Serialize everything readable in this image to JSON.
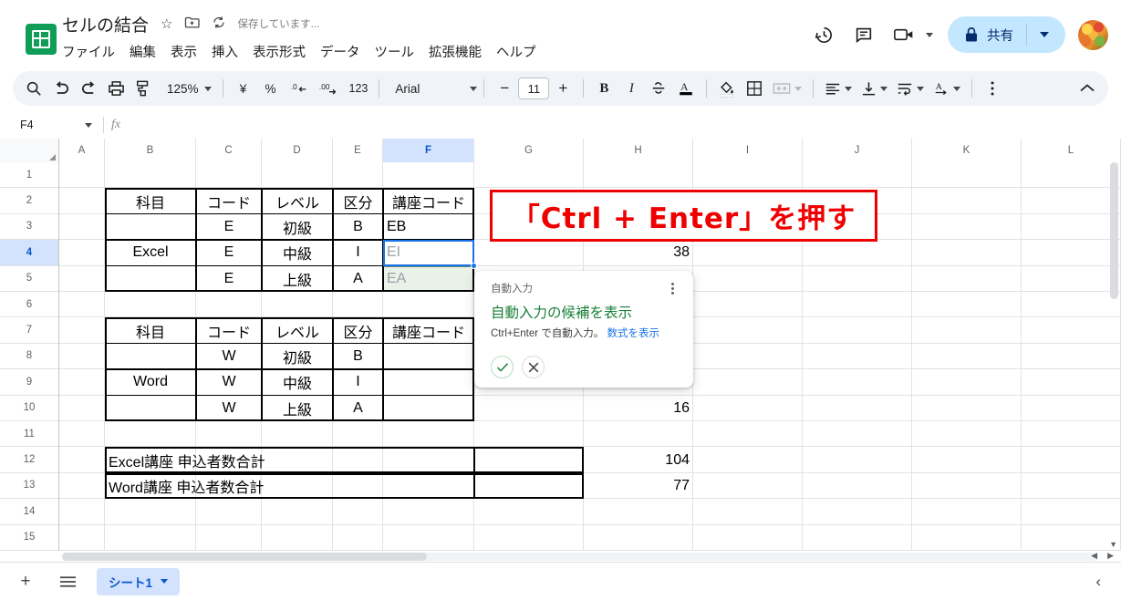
{
  "app": {
    "doc_title": "セルの結合",
    "saving_status": "保存しています...",
    "star_icon": "star-icon",
    "move_icon": "move-to-folder-icon",
    "cloud_icon": "drive-status-icon"
  },
  "menu": {
    "items": [
      {
        "label": "ファイル"
      },
      {
        "label": "編集"
      },
      {
        "label": "表示"
      },
      {
        "label": "挿入"
      },
      {
        "label": "表示形式"
      },
      {
        "label": "データ"
      },
      {
        "label": "ツール"
      },
      {
        "label": "拡張機能"
      },
      {
        "label": "ヘルプ"
      }
    ]
  },
  "top_right": {
    "history_icon": "version-history-icon",
    "comment_icon": "comment-icon",
    "meet_icon": "meet-camera-icon",
    "share_label": "共有",
    "share_bg": "#c2e7ff",
    "share_fg": "#062e6f"
  },
  "toolbar": {
    "search": "search-icon",
    "undo": "undo-icon",
    "redo": "redo-icon",
    "print": "print-icon",
    "paint": "paint-format-icon",
    "zoom_value": "125%",
    "currency": "¥",
    "percent": "%",
    "dec_decrease": ".0",
    "dec_increase": ".00",
    "more_formats": "123",
    "font_name": "Arial",
    "font_size": "11",
    "minus": "−",
    "plus": "+",
    "bold": "B",
    "italic": "I",
    "strikethrough": "strikethrough-icon",
    "text_color": "A",
    "fill_color": "fill-color-icon",
    "borders": "borders-icon",
    "merge": "merge-cells-icon",
    "align": "align-icon",
    "valign": "vertical-align-icon",
    "wrap": "text-wrap-icon",
    "rotate": "text-rotation-icon",
    "more": "more-options-icon",
    "collapse": "collapse-toolbar-icon"
  },
  "formula_bar": {
    "name_box": "F4",
    "fx": "fx",
    "formula_value": "",
    "placeholder": ""
  },
  "grid": {
    "columns": [
      "A",
      "B",
      "C",
      "D",
      "E",
      "F",
      "G",
      "H",
      "I",
      "J",
      "K",
      "L"
    ],
    "selected_column": "F",
    "rows": [
      "1",
      "2",
      "3",
      "4",
      "5",
      "6",
      "7",
      "8",
      "9",
      "10",
      "11",
      "12",
      "13",
      "14",
      "15"
    ],
    "selected_row": "4",
    "cells": [
      {
        "row": 2,
        "col": "B",
        "text": "科目",
        "align": "ctr"
      },
      {
        "row": 2,
        "col": "C",
        "text": "コード",
        "align": "ctr"
      },
      {
        "row": 2,
        "col": "D",
        "text": "レベル",
        "align": "ctr"
      },
      {
        "row": 2,
        "col": "E",
        "text": "区分",
        "align": "ctr"
      },
      {
        "row": 2,
        "col": "F",
        "text": "講座コード",
        "align": "ctr"
      },
      {
        "row": 3,
        "col": "B",
        "text": "",
        "align": "ctr"
      },
      {
        "row": 3,
        "col": "C",
        "text": "E",
        "align": "ctr"
      },
      {
        "row": 3,
        "col": "D",
        "text": "初級",
        "align": "ctr"
      },
      {
        "row": 3,
        "col": "E",
        "text": "B",
        "align": "ctr"
      },
      {
        "row": 3,
        "col": "F",
        "text": "EB",
        "align": "lft"
      },
      {
        "row": 4,
        "col": "C",
        "text": "E",
        "align": "ctr"
      },
      {
        "row": 4,
        "col": "D",
        "text": "中級",
        "align": "ctr"
      },
      {
        "row": 4,
        "col": "E",
        "text": "I",
        "align": "ctr"
      },
      {
        "row": 4,
        "col": "H",
        "text": "38",
        "align": "rgt"
      },
      {
        "row": 5,
        "col": "C",
        "text": "E",
        "align": "ctr"
      },
      {
        "row": 5,
        "col": "D",
        "text": "上級",
        "align": "ctr"
      },
      {
        "row": 5,
        "col": "E",
        "text": "A",
        "align": "ctr"
      },
      {
        "row": 7,
        "col": "B",
        "text": "科目",
        "align": "ctr"
      },
      {
        "row": 7,
        "col": "C",
        "text": "コード",
        "align": "ctr"
      },
      {
        "row": 7,
        "col": "D",
        "text": "レベル",
        "align": "ctr"
      },
      {
        "row": 7,
        "col": "E",
        "text": "区分",
        "align": "ctr"
      },
      {
        "row": 7,
        "col": "F",
        "text": "講座コード",
        "align": "ctr"
      },
      {
        "row": 8,
        "col": "C",
        "text": "W",
        "align": "ctr"
      },
      {
        "row": 8,
        "col": "D",
        "text": "初級",
        "align": "ctr"
      },
      {
        "row": 8,
        "col": "E",
        "text": "B",
        "align": "ctr"
      },
      {
        "row": 9,
        "col": "C",
        "text": "W",
        "align": "ctr"
      },
      {
        "row": 9,
        "col": "D",
        "text": "中級",
        "align": "ctr"
      },
      {
        "row": 9,
        "col": "E",
        "text": "I",
        "align": "ctr"
      },
      {
        "row": 10,
        "col": "C",
        "text": "W",
        "align": "ctr"
      },
      {
        "row": 10,
        "col": "D",
        "text": "上級",
        "align": "ctr"
      },
      {
        "row": 10,
        "col": "E",
        "text": "A",
        "align": "ctr"
      },
      {
        "row": 10,
        "col": "H",
        "text": "16",
        "align": "rgt"
      },
      {
        "row": 12,
        "col": "H",
        "text": "104",
        "align": "rgt"
      },
      {
        "row": 13,
        "col": "H",
        "text": "77",
        "align": "rgt"
      }
    ],
    "merged_cells": [
      {
        "label": "Excel",
        "col": "B",
        "row_start": 3,
        "row_end": 5
      },
      {
        "label": "Word",
        "col": "B",
        "row_start": 8,
        "row_end": 10
      },
      {
        "label": "Excel講座 申込者数合計",
        "col": "B",
        "row_start": 12,
        "row_end": 12,
        "span_cols": 5,
        "align": "lft"
      },
      {
        "label": "Word講座 申込者数合計",
        "col": "B",
        "row_start": 13,
        "row_end": 13,
        "span_cols": 5,
        "align": "lft"
      }
    ],
    "autofill_preview": [
      {
        "row": 4,
        "col": "F",
        "text": "EI",
        "state": "selected"
      },
      {
        "row": 5,
        "col": "F",
        "text": "EA",
        "state": "suggested"
      }
    ],
    "selection": {
      "cell": "F4",
      "border_color": "#1a73e8",
      "suggest_bg": "#e8f2e9",
      "suggest_border": "#5f8c68"
    }
  },
  "annotation": {
    "text": "「Ctrl + Enter」を押す",
    "color": "#ef0000",
    "bg": "#ffffff"
  },
  "autofill_popup": {
    "eyebrow": "自動入力",
    "title": "自動入力の候補を表示",
    "subtitle_prefix": "Ctrl+Enter で自動入力。",
    "link": "数式を表示",
    "accept_icon": "check-icon",
    "dismiss_icon": "close-icon",
    "menu_icon": "kebab-menu-icon",
    "title_color": "#188038",
    "link_color": "#1a73e8"
  },
  "bottom_bar": {
    "add_sheet": "+",
    "all_sheets": "all-sheets-icon",
    "sheet_tab": "シート1",
    "collapse": "‹"
  }
}
